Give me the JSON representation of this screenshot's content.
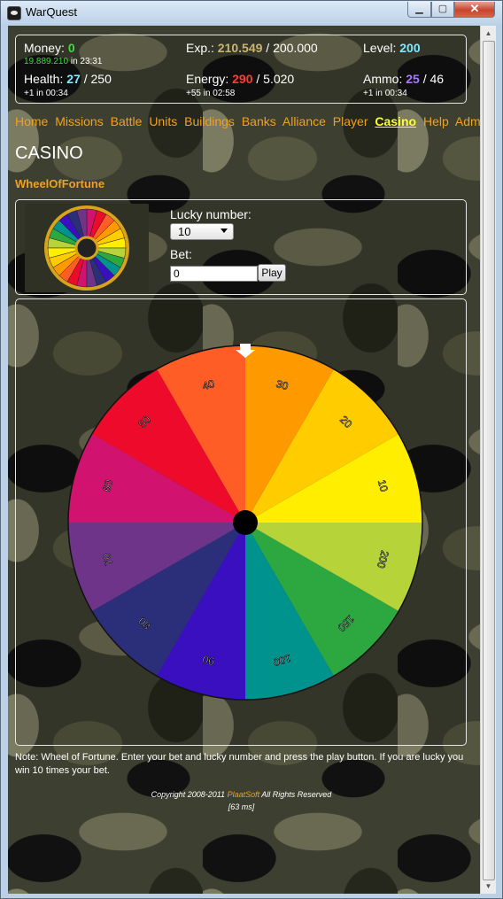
{
  "window": {
    "title": "WarQuest"
  },
  "stats": {
    "money_label": "Money:",
    "money_value": "0",
    "money_sub_value": "19.889.210",
    "money_sub_suffix": " in 23:31",
    "exp_label": "Exp.:",
    "exp_value": "210.549",
    "exp_max": " / 200.000",
    "level_label": "Level:",
    "level_value": "200",
    "health_label": "Health:",
    "health_value": "27",
    "health_max": " / 250",
    "health_sub": "+1 in 00:34",
    "energy_label": "Energy:",
    "energy_value": "290",
    "energy_max": " / 5.020",
    "energy_sub": "+55 in 02:58",
    "ammo_label": "Ammo:",
    "ammo_value": "25",
    "ammo_max": " / 46",
    "ammo_sub": "+1 in 00:34"
  },
  "nav": {
    "items": [
      "Home",
      "Missions",
      "Battle",
      "Units",
      "Buildings",
      "Banks",
      "Alliance",
      "Player",
      "Casino",
      "Help",
      "Admin"
    ],
    "active": "Casino"
  },
  "page": {
    "title": "CASINO",
    "subtitle": "WheelOfFortune"
  },
  "form": {
    "lucky_label": "Lucky number:",
    "lucky_value": "10",
    "bet_label": "Bet:",
    "bet_value": "0",
    "play_label": "Play"
  },
  "wheel": {
    "segments": [
      {
        "label": "10",
        "color": "#ffee00"
      },
      {
        "label": "20",
        "color": "#ffcc00"
      },
      {
        "label": "30",
        "color": "#ff9900"
      },
      {
        "label": "40",
        "color": "#ff5c26"
      },
      {
        "label": "50",
        "color": "#ee0a2b"
      },
      {
        "label": "60",
        "color": "#d1136f"
      },
      {
        "label": "70",
        "color": "#6e3489"
      },
      {
        "label": "80",
        "color": "#2b2f7a"
      },
      {
        "label": "90",
        "color": "#3a0fc0"
      },
      {
        "label": "100",
        "color": "#00928c"
      },
      {
        "label": "150",
        "color": "#2da840"
      },
      {
        "label": "200",
        "color": "#b6d43a"
      }
    ]
  },
  "footer": {
    "note": "Note: Wheel of Fortune. Enter your bet and lucky number and press the play button. If you are lucky you win 10 times your bet.",
    "copyright_prefix": "Copyright 2008-2011 ",
    "copyright_brand": "PlaatSoft",
    "copyright_suffix": " All Rights Reserved",
    "timing": "[63 ms]"
  }
}
